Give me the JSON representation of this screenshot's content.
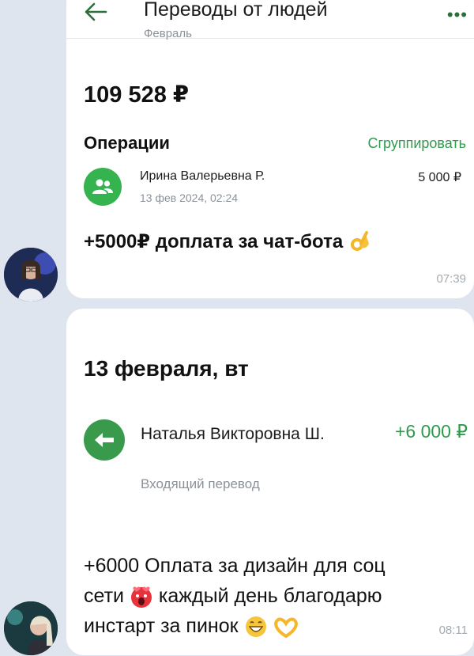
{
  "header": {
    "title": "Переводы от людей",
    "subtitle": "Февраль",
    "back_icon": "arrow-left-icon",
    "menu_icon": "more-dots-icon"
  },
  "summary": {
    "balance": "109 528 ₽",
    "operations_title": "Операции",
    "group_label": "Сгруппировать"
  },
  "operation1": {
    "icon": "people-icon",
    "name": "Ирина Валерьевна Р.",
    "date": "13 фев 2024, 02:24",
    "amount": "5 000 ₽"
  },
  "message1": {
    "text": "+5000₽ доплата за чат-бота",
    "emoji": "ok-hand-emoji",
    "time": "07:39"
  },
  "card2": {
    "date_heading": "13 февраля, вт",
    "operation": {
      "icon": "arrow-left-circle-icon",
      "name": "Наталья Викторовна Ш.",
      "amount": "+6 000 ₽",
      "type": "Входящий перевод"
    }
  },
  "message2": {
    "line1": "+6000 Оплата за дизайн для соц",
    "line2a": "сети",
    "line2b": "каждый день благодарю",
    "line3": "инстарт за пинок",
    "time": "08:11"
  },
  "colors": {
    "accent_green": "#2f9a4c",
    "icon_green": "#34b34f",
    "chat_bg": "#dfe5ee"
  }
}
